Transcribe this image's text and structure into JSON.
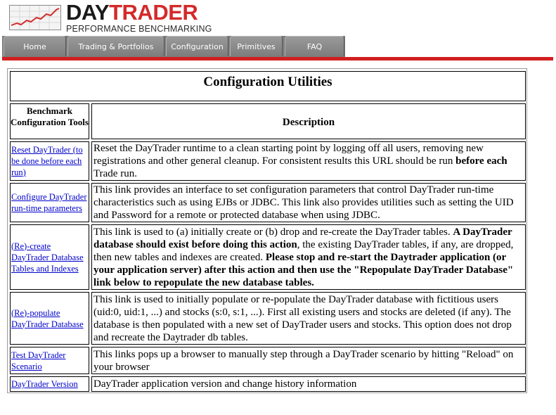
{
  "logo": {
    "title_part1": "DAY",
    "title_part2": "TRADER",
    "subtitle": "PERFORMANCE BENCHMARKING",
    "icon": "stock-chart-icon",
    "accent_color": "#d42a2a"
  },
  "nav": {
    "tabs": [
      {
        "label": "Home"
      },
      {
        "label": "Trading & Portfolios"
      },
      {
        "label": "Configuration"
      },
      {
        "label": "Primitives"
      },
      {
        "label": "FAQ"
      }
    ]
  },
  "config": {
    "title": "Configuration Utilities",
    "col_tools": "Benchmark Configuration Tools",
    "col_desc": "Description",
    "rows": [
      {
        "link": "Reset DayTrader (to be done before each run)",
        "desc_a": "Reset the DayTrader runtime to a clean starting point by logging off all users, removing new registrations and other general cleanup. For consistent results this URL should be run ",
        "desc_b": "before each",
        "desc_c": " Trade run."
      },
      {
        "link": "Configure DayTrader run-time parameters",
        "desc_a": "This link provides an interface to set configuration parameters that control DayTrader run-time characteristics such as using EJBs or JDBC. This link also provides utilities such as setting the UID and Password for a remote or protected database when using JDBC."
      },
      {
        "link": "(Re)-create  DayTrader Database Tables and Indexes",
        "desc_a": "This link is used to (a) initially create or (b) drop and re-create the DayTrader tables. ",
        "desc_b": "A DayTrader database should exist before doing this action",
        "desc_c": ", the existing DayTrader tables, if any, are dropped, then new tables and indexes are created. ",
        "desc_d": "Please stop and re-start the Daytrader application (or your application server) after this action and then use the \"Repopulate DayTrader Database\" link below to repopulate the new database tables."
      },
      {
        "link": "(Re)-populate  DayTrader Database",
        "desc_a": "This link is used to initially populate or re-populate the DayTrader database with fictitious users (uid:0, uid:1, ...) and stocks (s:0, s:1, ...). First all existing users and stocks are deleted (if any). The database is then populated with a new set of DayTrader users and stocks. This option does not drop and recreate the Daytrader db tables."
      },
      {
        "link": "Test DayTrader Scenario",
        "desc_a": "This links pops up a browser to manually step through a DayTrader scenario by hitting \"Reload\" on your browser"
      },
      {
        "link": "DayTrader Version",
        "desc_a": "DayTrader application version and change history information"
      }
    ]
  }
}
